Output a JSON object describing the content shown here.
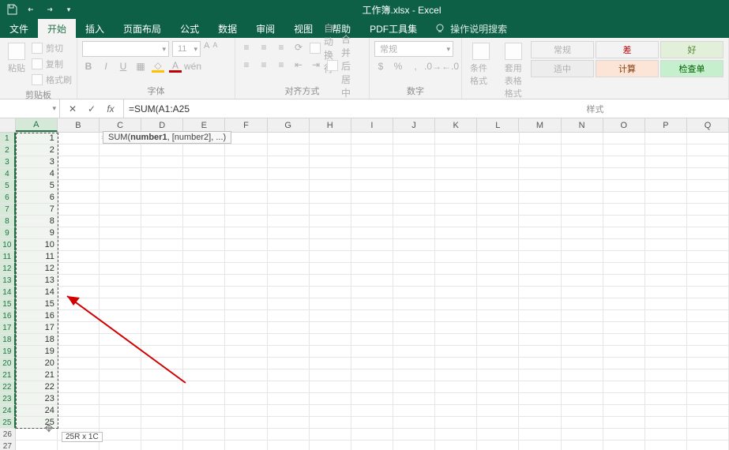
{
  "titlebar": {
    "title": "工作簿.xlsx - Excel"
  },
  "tabs": {
    "file": "文件",
    "items": [
      "开始",
      "插入",
      "页面布局",
      "公式",
      "数据",
      "审阅",
      "视图",
      "帮助",
      "PDF工具集"
    ],
    "active_index": 0,
    "tellme": "操作说明搜索"
  },
  "ribbon": {
    "clipboard": {
      "paste": "粘贴",
      "cut": "剪切",
      "copy": "复制",
      "format_painter": "格式刷",
      "group_label": "剪贴板"
    },
    "font": {
      "font_name": "",
      "font_size": "11",
      "group_label": "字体",
      "buttons": {
        "b": "B",
        "i": "I",
        "u": "U"
      }
    },
    "alignment": {
      "wrap": "自动换行",
      "merge": "合并后居中",
      "group_label": "对齐方式"
    },
    "number": {
      "format": "常规",
      "group_label": "数字"
    },
    "styles": {
      "cond": "条件格式",
      "table": "套用\n表格格式",
      "normal": "常规",
      "bad": "差",
      "good": "好",
      "neutral": "适中",
      "calc": "计算",
      "check": "检查单",
      "group_label": "样式"
    }
  },
  "fxrow": {
    "namebox": "",
    "fx_label": "fx",
    "formula": "=SUM(A1:A25"
  },
  "grid": {
    "columns": [
      "A",
      "B",
      "C",
      "D",
      "E",
      "F",
      "G",
      "H",
      "I",
      "J",
      "K",
      "L",
      "M",
      "N",
      "O",
      "P",
      "Q"
    ],
    "rows": 27,
    "col_a_values": [
      1,
      2,
      3,
      4,
      5,
      6,
      7,
      8,
      9,
      10,
      11,
      12,
      13,
      14,
      15,
      16,
      17,
      18,
      19,
      20,
      21,
      22,
      23,
      24,
      25
    ],
    "formula_display": {
      "kw": "=SUM(",
      "ref": "A1:A25"
    },
    "tooltip": {
      "fn": "SUM(",
      "bold": "number1",
      "rest": ", [number2], ...)"
    },
    "sel_counter": "25R x 1C"
  }
}
